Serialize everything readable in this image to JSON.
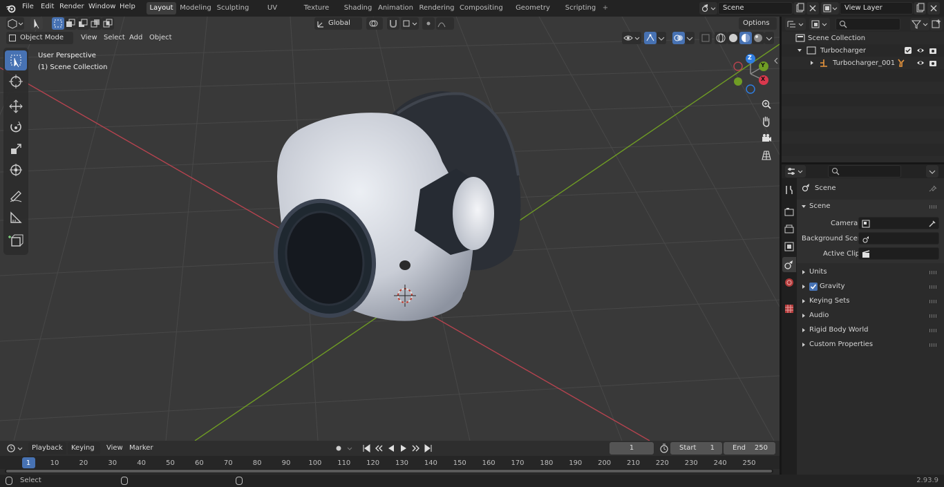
{
  "topbar": {
    "menus": [
      "File",
      "Edit",
      "Render",
      "Window",
      "Help"
    ],
    "workspaces": [
      "Layout",
      "Modeling",
      "Sculpting",
      "UV Editing",
      "Texture Paint",
      "Shading",
      "Animation",
      "Rendering",
      "Compositing",
      "Geometry Nodes",
      "Scripting"
    ],
    "active_workspace": "Layout",
    "add_workspace": "+",
    "scene_name": "Scene",
    "view_layer_name": "View Layer"
  },
  "viewport_header": {
    "mode": "Object Mode",
    "menus": [
      "View",
      "Select",
      "Add",
      "Object"
    ],
    "orientation": "Global",
    "options_label": "Options"
  },
  "viewport": {
    "view_name": "User Perspective",
    "collection_label": "(1) Scene Collection",
    "gizmo_axes": {
      "x": "X",
      "y": "Y",
      "z": "Z"
    }
  },
  "outliner": {
    "root": "Scene Collection",
    "collection": "Turbocharger",
    "object": "Turbocharger_001"
  },
  "properties": {
    "context_title": "Scene",
    "panel_title": "Scene",
    "fields": [
      {
        "label": "Camera",
        "value": ""
      },
      {
        "label": "Background Scene",
        "value": ""
      },
      {
        "label": "Active Clip",
        "value": ""
      }
    ],
    "subpanels": [
      "Units",
      "Gravity",
      "Keying Sets",
      "Audio",
      "Rigid Body World",
      "Custom Properties"
    ],
    "gravity_enabled": true
  },
  "timeline": {
    "menus": [
      "Playback",
      "Keying",
      "View",
      "Marker"
    ],
    "current_frame": "1",
    "start_label": "Start",
    "start_value": "1",
    "end_label": "End",
    "end_value": "250",
    "ticks": [
      "1",
      "10",
      "20",
      "30",
      "40",
      "50",
      "60",
      "70",
      "80",
      "90",
      "100",
      "110",
      "120",
      "130",
      "140",
      "150",
      "160",
      "170",
      "180",
      "190",
      "200",
      "210",
      "220",
      "230",
      "240",
      "250"
    ]
  },
  "statusbar": {
    "left_label": "Select",
    "version": "2.93.9"
  },
  "colors": {
    "accent": "#4772b3",
    "x_axis": "#b5434f",
    "y_axis": "#6f9c24",
    "z_axis": "#2f7de0",
    "viewport_bg": "#393939"
  }
}
